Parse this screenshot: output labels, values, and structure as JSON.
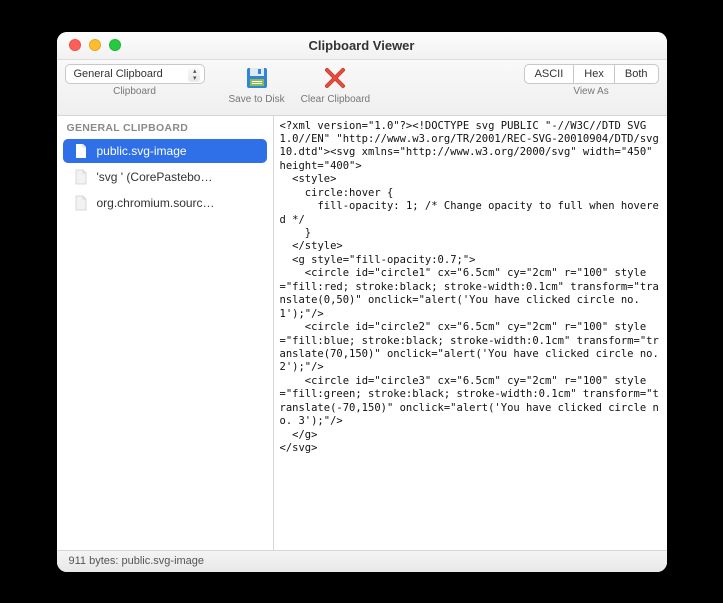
{
  "window": {
    "title": "Clipboard Viewer"
  },
  "toolbar": {
    "clipboard_group_label": "Clipboard",
    "clipboard_selected": "General Clipboard",
    "save_label": "Save to Disk",
    "clear_label": "Clear Clipboard",
    "viewas_label": "View As",
    "seg": {
      "ascii": "ASCII",
      "hex": "Hex",
      "both": "Both"
    }
  },
  "sidebar": {
    "section": "GENERAL CLIPBOARD",
    "items": [
      {
        "label": "public.svg-image",
        "selected": true,
        "dim": false
      },
      {
        "label": "'svg ' (CorePastebo…",
        "selected": false,
        "dim": true
      },
      {
        "label": "org.chromium.sourc…",
        "selected": false,
        "dim": true
      }
    ]
  },
  "content": {
    "text": "<?xml version=\"1.0\"?><!DOCTYPE svg PUBLIC \"-//W3C//DTD SVG 1.0//EN\" \"http://www.w3.org/TR/2001/REC-SVG-20010904/DTD/svg10.dtd\"><svg xmlns=\"http://www.w3.org/2000/svg\" width=\"450\" height=\"400\">\n  <style>\n    circle:hover {\n      fill-opacity: 1; /* Change opacity to full when hovered */\n    }\n  </style>\n  <g style=\"fill-opacity:0.7;\">\n    <circle id=\"circle1\" cx=\"6.5cm\" cy=\"2cm\" r=\"100\" style=\"fill:red; stroke:black; stroke-width:0.1cm\" transform=\"translate(0,50)\" onclick=\"alert('You have clicked circle no. 1');\"/>\n    <circle id=\"circle2\" cx=\"6.5cm\" cy=\"2cm\" r=\"100\" style=\"fill:blue; stroke:black; stroke-width:0.1cm\" transform=\"translate(70,150)\" onclick=\"alert('You have clicked circle no. 2');\"/>\n    <circle id=\"circle3\" cx=\"6.5cm\" cy=\"2cm\" r=\"100\" style=\"fill:green; stroke:black; stroke-width:0.1cm\" transform=\"translate(-70,150)\" onclick=\"alert('You have clicked circle no. 3');\"/>\n  </g>\n</svg>"
  },
  "statusbar": {
    "text": "911 bytes: public.svg-image"
  }
}
